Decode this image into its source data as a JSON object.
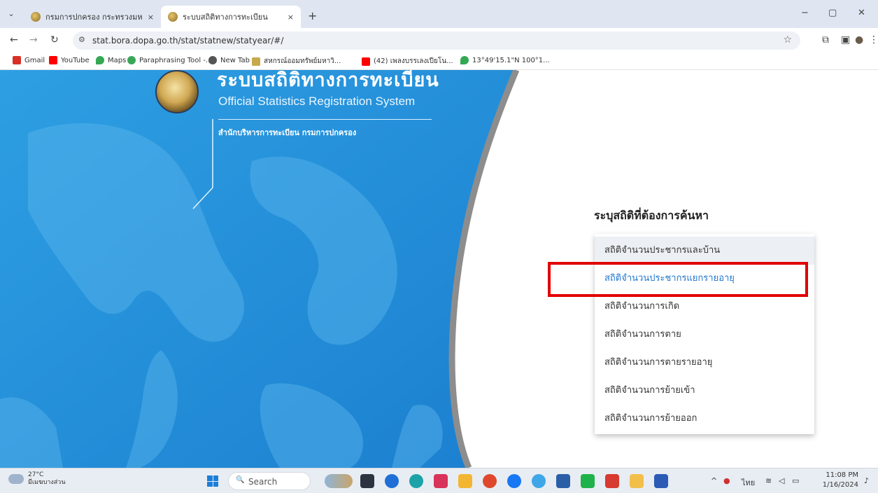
{
  "browser": {
    "tabs": [
      {
        "title": "กรมการปกครอง กระทรวงมหาดไทย",
        "active": false
      },
      {
        "title": "ระบบสถิติทางการทะเบียน",
        "active": true
      }
    ],
    "tab_close": "×",
    "new_tab": "+",
    "menu_glyph": "⌄",
    "window_controls": {
      "minimize": "−",
      "maximize": "▢",
      "close": "✕"
    },
    "nav": {
      "back": "←",
      "forward": "→",
      "reload": "↻"
    },
    "url": "stat.bora.dopa.go.th/stat/statnew/statyear/#/",
    "site_info_glyph": "⚙",
    "star_glyph": "☆",
    "toolbar_icons": {
      "extensions": "⧉",
      "sidepanel": "▣",
      "profile": "●",
      "more": "⋮"
    },
    "bookmarks": [
      {
        "label": "Gmail",
        "color": "#d93025"
      },
      {
        "label": "YouTube",
        "color": "#ff0000"
      },
      {
        "label": "Maps",
        "color": "#34a853"
      },
      {
        "label": "Paraphrasing Tool -...",
        "color": "#3aa757"
      },
      {
        "label": "New Tab",
        "color": "#555555"
      },
      {
        "label": "สหกรณ์ออมทรัพย์มหาวิ...",
        "color": "#c8a84a"
      },
      {
        "label": "(42) เพลงบรรเลงเปียโน...",
        "color": "#ff0000"
      },
      {
        "label": "13°49'15.1\"N 100°1...",
        "color": "#34a853"
      }
    ]
  },
  "page": {
    "title_th": "ระบบสถิติทางการทะเบียน",
    "title_en": "Official Statistics Registration System",
    "subtitle": "สำนักบริหารการทะเบียน กรมการปกครอง",
    "menu_title": "ระบุสถิติที่ต้องการค้นหา",
    "menu_items": [
      "สถิติจำนวนประชากรและบ้าน",
      "สถิติจำนวนประชากรแยกรายอายุ",
      "สถิติจำนวนการเกิด",
      "สถิติจำนวนการตาย",
      "สถิติจำนวนการตายรายอายุ",
      "สถิติจำนวนการย้ายเข้า",
      "สถิติจำนวนการย้ายออก"
    ],
    "accent_color": "#1f76d0",
    "highlight_color": "#e10000"
  },
  "taskbar": {
    "weather_temp": "27°C",
    "weather_desc": "มีเมฆบางส่วน",
    "search_glyph": "🔍",
    "search_label": "Search",
    "tray_chevron": "^",
    "language": "ไทย",
    "time": "11:08 PM",
    "date": "1/16/2024"
  }
}
